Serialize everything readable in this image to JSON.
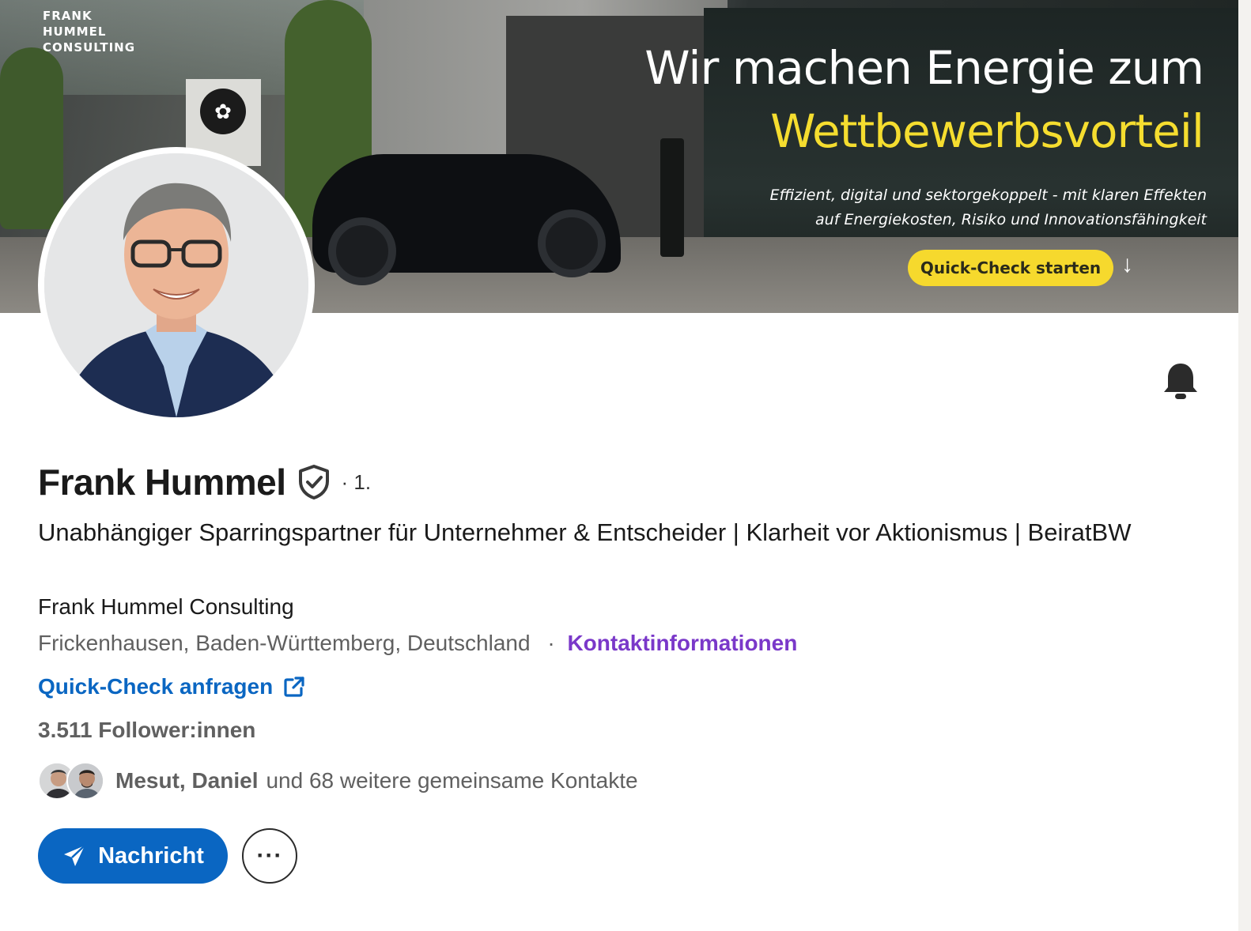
{
  "banner": {
    "brand_line1": "FRANK",
    "brand_line2": "HUMMEL",
    "brand_line3": "CONSULTING",
    "headline_line1": "Wir machen Energie zum",
    "headline_line2": "Wettbewerbsvorteil",
    "tagline_line1": "Effizient, digital und sektorgekoppelt - mit klaren Effekten",
    "tagline_line2": "auf Energiekosten, Risiko und Innovationsfähingkeit",
    "cta_label": "Quick-Check starten",
    "accent_color": "#f5dd2f"
  },
  "profile": {
    "name": "Frank Hummel",
    "degree": "· 1.",
    "headline": "Unabhängiger Sparringspartner für Unternehmer & Entscheider | Klarheit vor Aktionismus | BeiratBW",
    "company": "Frank Hummel Consulting",
    "location": "Frickenhausen, Baden-Württemberg, Deutschland",
    "location_separator": "·",
    "contact_info_label": "Kontaktinformationen",
    "website_label": "Quick-Check anfragen",
    "followers": "3.511 Follower:innen",
    "mutual_names": "Mesut, Daniel",
    "mutual_rest": "und 68 weitere gemeinsame Kontakte"
  },
  "actions": {
    "message_label": "Nachricht",
    "more_label": "···"
  },
  "icons": {
    "bell": "bell-icon",
    "verify": "verified-shield-icon",
    "external": "external-link-icon",
    "send": "paper-plane-icon"
  },
  "colors": {
    "primary": "#0a66c2",
    "contact_link": "#7a38c9",
    "muted_text": "#606060"
  }
}
